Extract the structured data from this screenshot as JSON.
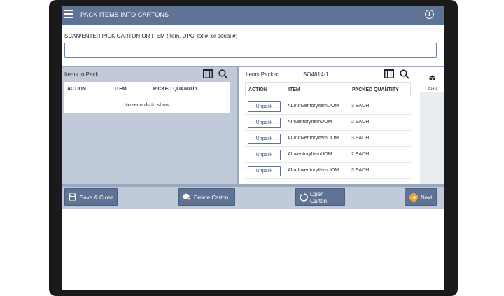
{
  "header": {
    "title": "PACK ITEMS INTO CARTONS",
    "menu_icon": "hamburger-menu-icon",
    "info_icon": "info-icon"
  },
  "scan": {
    "label": "SCAN/ENTER PICK CARTON OR ITEM (Item, UPC, lot #, or serial #)",
    "value": "",
    "placeholder": ""
  },
  "items_to_pack": {
    "title": "Items to Pack",
    "columns": [
      "ACTION",
      "ITEM",
      "PICKED QUANTITY"
    ],
    "empty_message": "No records to show."
  },
  "items_packed": {
    "title": "Items Packed",
    "carton_id": "SO4814-1",
    "columns": [
      "ACTION",
      "ITEM",
      "PACKED QUANTITY"
    ],
    "rows": [
      {
        "action": "Unpack",
        "item": "ALotInventoryItemUOM",
        "qty": "3 EACH"
      },
      {
        "action": "Unpack",
        "item": "AInventoryItemUOM",
        "qty": "2 EACH"
      },
      {
        "action": "Unpack",
        "item": "ALotInventoryItemUOM",
        "qty": "3 EACH"
      },
      {
        "action": "Unpack",
        "item": "AInventoryItemUOM",
        "qty": "2 EACH"
      },
      {
        "action": "Unpack",
        "item": "ALotInventoryItemUOM",
        "qty": "3 EACH"
      }
    ]
  },
  "carton_tab": {
    "label": "_814-1"
  },
  "actions": {
    "save_close": "Save & Close",
    "delete_carton": "Delete Carton",
    "open_carton_line1": "Open",
    "open_carton_line2": "Carton",
    "next": "Next"
  },
  "colors": {
    "header_bg": "#5f7394",
    "panel_bg": "#c1cad8",
    "accent": "#6b84ad",
    "next_icon": "#f5a623"
  }
}
